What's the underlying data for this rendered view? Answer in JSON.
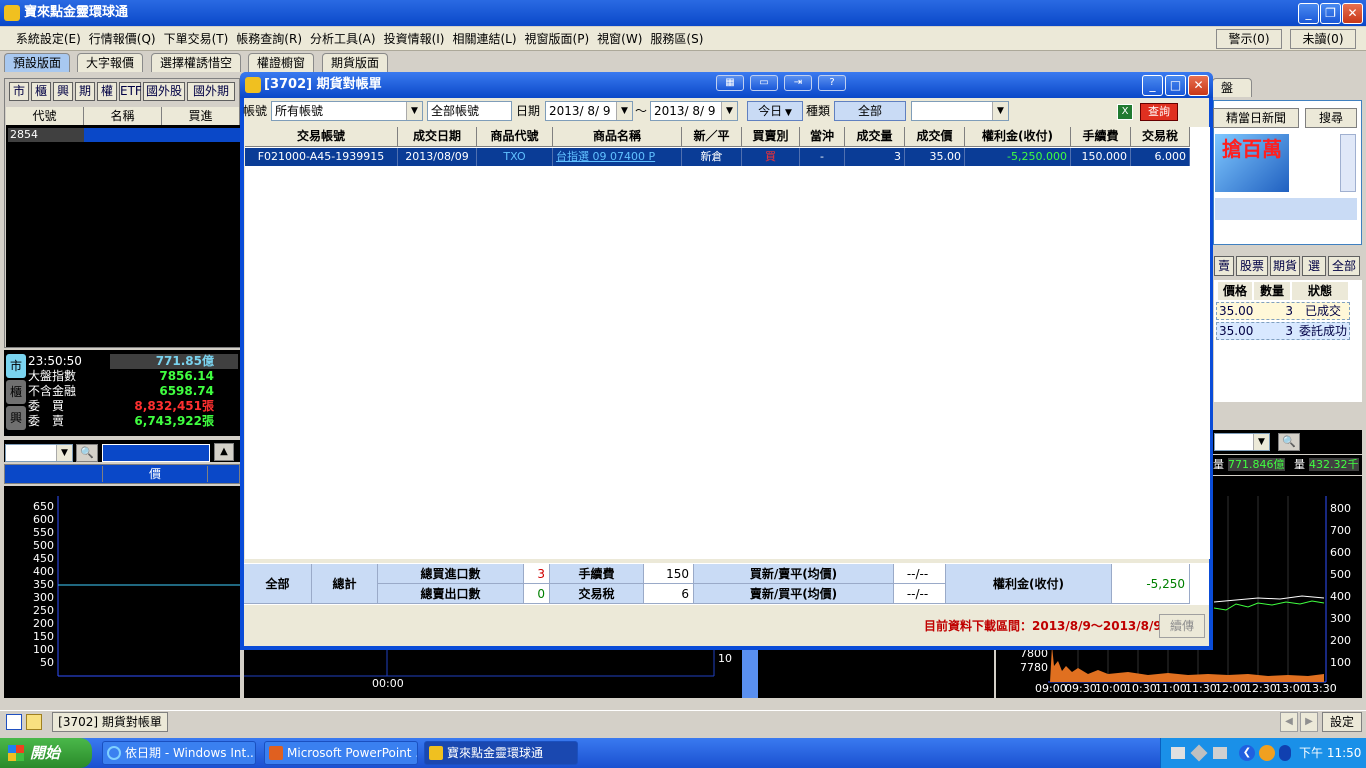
{
  "app": {
    "title": "寶來點金靈環球通",
    "warn_btn": "警示(0)",
    "unread_btn": "未讀(0)"
  },
  "menu": [
    "系統設定(E)",
    "行情報價(Q)",
    "下單交易(T)",
    "帳務查詢(R)",
    "分析工具(A)",
    "投資情報(I)",
    "相關連結(L)",
    "視窗版面(P)",
    "視窗(W)",
    "服務區(S)"
  ],
  "layout_tabs": [
    "預設版面",
    "大字報價",
    "選擇權誘惜空",
    "權證櫥窗",
    "期貨版面"
  ],
  "left_panel": {
    "quote_btns": [
      "市",
      "櫃",
      "興",
      "期",
      "權",
      "ETF",
      "國外股",
      "國外期"
    ],
    "cols": [
      "代號",
      "名稱",
      "買進"
    ],
    "row_code": "2854",
    "side_tabs": [
      "市",
      "櫃",
      "興"
    ],
    "time": "23:50:50",
    "total_amount": "771.85億",
    "stats": [
      {
        "label": "大盤指數",
        "value": "7856.14",
        "color": "#40ff40"
      },
      {
        "label": "不含金融",
        "value": "6598.74",
        "color": "#40ff40"
      },
      {
        "label": "委　買",
        "value": "8,832,451張",
        "color": "#ff3030"
      },
      {
        "label": "委　賣",
        "value": "6,743,922張",
        "color": "#40ff40"
      }
    ],
    "chart_header": "價",
    "chart_ticks": [
      "650",
      "600",
      "550",
      "500",
      "450",
      "400",
      "350",
      "300",
      "250",
      "200",
      "150",
      "100",
      "50"
    ],
    "x_label": "00:00",
    "right_val": "10"
  },
  "dialog": {
    "title": "[3702] 期貨對帳單",
    "account_label": "帳號",
    "account_value": "所有帳號",
    "account_name": "全部帳號",
    "date_label": "日期",
    "date_from": "2013/ 8/ 9",
    "tilde": "～",
    "date_to": "2013/ 8/ 9",
    "today_btn": "今日",
    "type_label": "種類",
    "type_btn": "全部",
    "query_btn": "查詢",
    "columns": [
      "交易帳號",
      "成交日期",
      "商品代號",
      "商品名稱",
      "新／平",
      "買賣別",
      "當沖",
      "成交量",
      "成交價",
      "權利金(收付)",
      "手續費",
      "交易稅"
    ],
    "row": [
      "F021000-A45-1939915",
      "2013/08/09",
      "TXO",
      "台指選 09 07400 P",
      "新倉",
      "買",
      "-",
      "3",
      "35.00",
      "-5,250.000",
      "150.000",
      "6.000"
    ],
    "summary": {
      "all": "全部",
      "total": "總計",
      "buy_count_label": "總買進口數",
      "buy_count": "3",
      "sell_count_label": "總賣出口數",
      "sell_count": "0",
      "fee_label": "手續費",
      "fee": "150",
      "tax_label": "交易稅",
      "tax": "6",
      "buy_new_label": "買新/賣平(均價)",
      "buy_new": "--/--",
      "sell_new_label": "賣新/買平(均價)",
      "sell_new": "--/--",
      "premium_label": "權利金(收付)",
      "premium": "-5,250"
    },
    "range_text": "目前資料下載區間：2013/8/9～2013/8/9",
    "resend_btn": "續傳"
  },
  "right_panel": {
    "tab_label": "盤",
    "news_btn": "精當日新聞",
    "search_btn": "搜尋",
    "ad_text": "搶百萬",
    "filter_btns": [
      "賣",
      "股票",
      "期貨",
      "選",
      "全部"
    ],
    "cols": [
      "價格",
      "數量",
      "狀態"
    ],
    "rows": [
      [
        "35.00",
        "3",
        "已成交"
      ],
      [
        "35.00",
        "3",
        "委託成功"
      ]
    ],
    "vol_label": "量",
    "vol1": "771.846億",
    "vol2": "432.32千",
    "y_ticks": [
      "800",
      "700",
      "600",
      "500",
      "400",
      "300",
      "200",
      "100"
    ],
    "left_ticks": [
      "7800",
      "7780"
    ],
    "x_ticks": [
      "09:00",
      "09:30",
      "10:00",
      "10:30",
      "11:00",
      "11:30",
      "12:00",
      "12:30",
      "13:00",
      "13:30"
    ]
  },
  "statusbar": {
    "window_btn": "[3702] 期貨對帳單",
    "settings_btn": "設定"
  },
  "taskbar": {
    "start": "開始",
    "tasks": [
      "依日期 - Windows Int...",
      "Microsoft PowerPoint ...",
      "寶來點金靈環球通"
    ],
    "clock": "下午 11:50"
  }
}
